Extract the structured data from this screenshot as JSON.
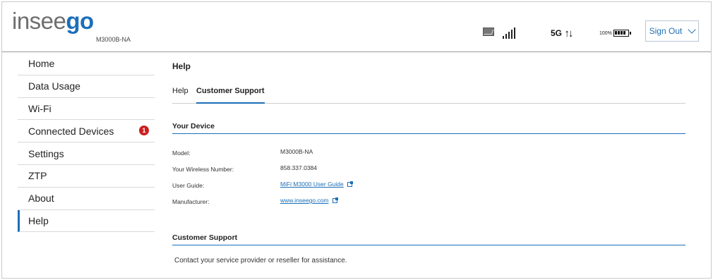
{
  "brand": {
    "logo_a": "insee",
    "logo_b": "go",
    "model_sub": "M3000B-NA"
  },
  "status": {
    "network": "5G",
    "arrows": "↑↓",
    "battery_pct": "100%",
    "signal_bars": 5
  },
  "header": {
    "signout_label": "Sign Out"
  },
  "sidebar": {
    "items": [
      {
        "label": "Home"
      },
      {
        "label": "Data Usage"
      },
      {
        "label": "Wi-Fi"
      },
      {
        "label": "Connected Devices",
        "badge": "1"
      },
      {
        "label": "Settings"
      },
      {
        "label": "ZTP"
      },
      {
        "label": "About"
      },
      {
        "label": "Help"
      }
    ]
  },
  "main": {
    "title": "Help",
    "tabs": [
      {
        "label": "Help"
      },
      {
        "label": "Customer Support"
      }
    ],
    "your_device": {
      "title": "Your Device",
      "rows": [
        {
          "label": "Model:",
          "value": "M3000B-NA"
        },
        {
          "label": "Your Wireless Number:",
          "value": "858.337.0384"
        },
        {
          "label": "User Guide:",
          "value": "MiFi M3000 User Guide"
        },
        {
          "label": "Manufacturer:",
          "value": "www.inseego.com"
        }
      ]
    },
    "customer_support": {
      "title": "Customer Support",
      "text": "Contact your service provider or reseller for assistance."
    }
  },
  "colors": {
    "accent": "#1d6fb8",
    "badge": "#cc1f1f"
  }
}
